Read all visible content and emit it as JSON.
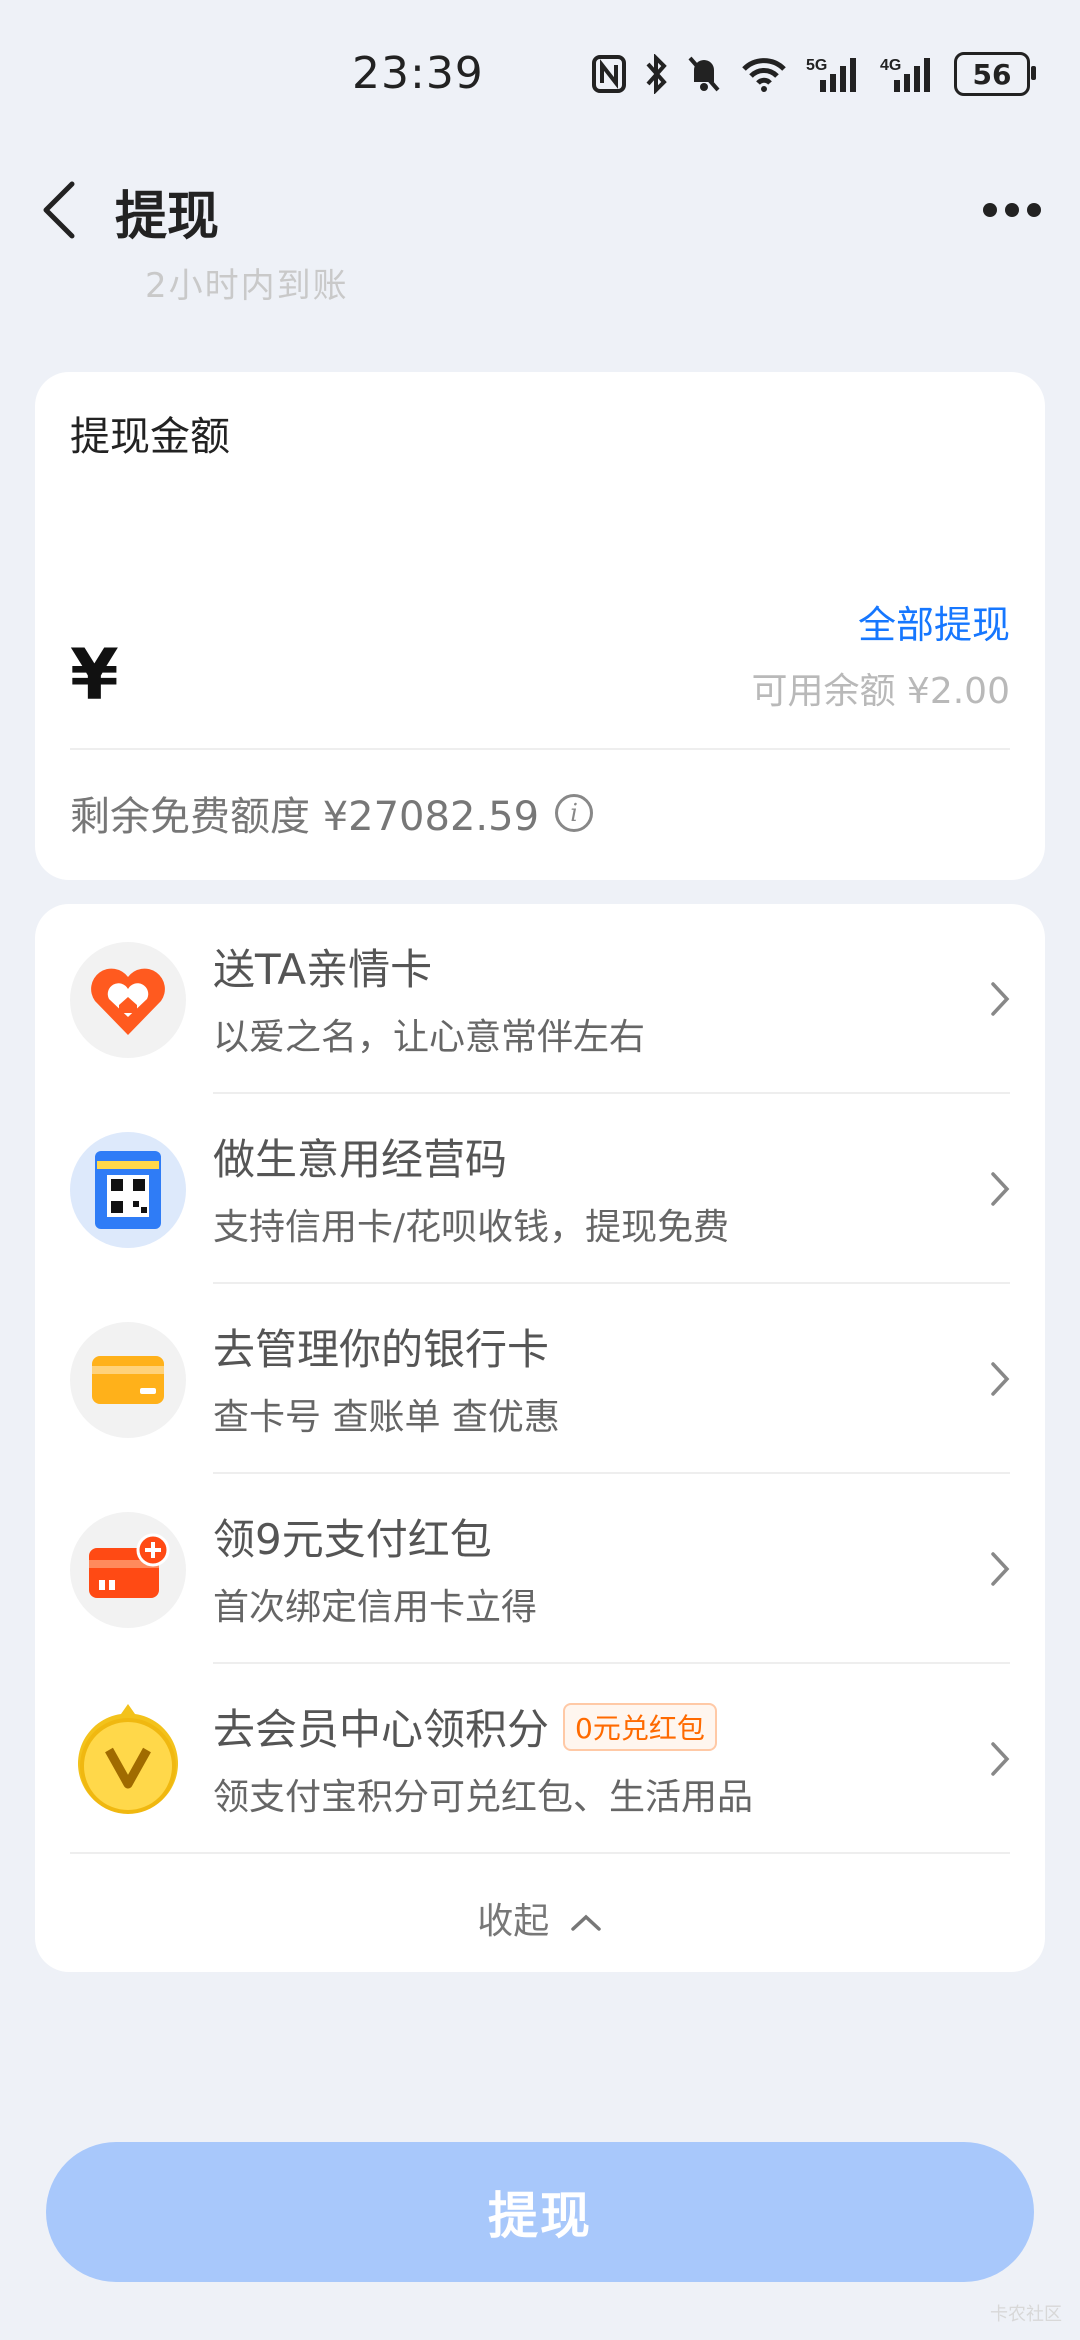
{
  "status": {
    "time": "23:39",
    "battery": "56",
    "net1": "5G",
    "net2": "4G"
  },
  "header": {
    "title": "提现"
  },
  "faded": "2小时内到账",
  "amount": {
    "label": "提现金额",
    "withdraw_all": "全部提现",
    "currency": "¥",
    "available": "可用余额 ¥2.00",
    "free_quota": "剩余免费额度 ¥27082.59"
  },
  "list": {
    "items": [
      {
        "title": "送TA亲情卡",
        "sub": "以爱之名，让心意常伴左右",
        "icon": "heart-home-icon"
      },
      {
        "title": "做生意用经营码",
        "sub": "支持信用卡/花呗收钱，提现免费",
        "icon": "qr-code-icon"
      },
      {
        "title": "去管理你的银行卡",
        "sub": "查卡号 查账单 查优惠",
        "icon": "bank-card-icon"
      },
      {
        "title": "领9元支付红包",
        "sub": "首次绑定信用卡立得",
        "icon": "credit-card-plus-icon"
      },
      {
        "title": "去会员中心领积分",
        "sub": "领支付宝积分可兑红包、生活用品",
        "badge": "0元兑红包",
        "icon": "member-v-icon"
      }
    ],
    "collapse": "收起"
  },
  "submit": "提现",
  "watermark": "卡农社区",
  "colors": {
    "accent": "#1677ff",
    "button": "#a8c8fb",
    "background": "#eef1f7"
  }
}
